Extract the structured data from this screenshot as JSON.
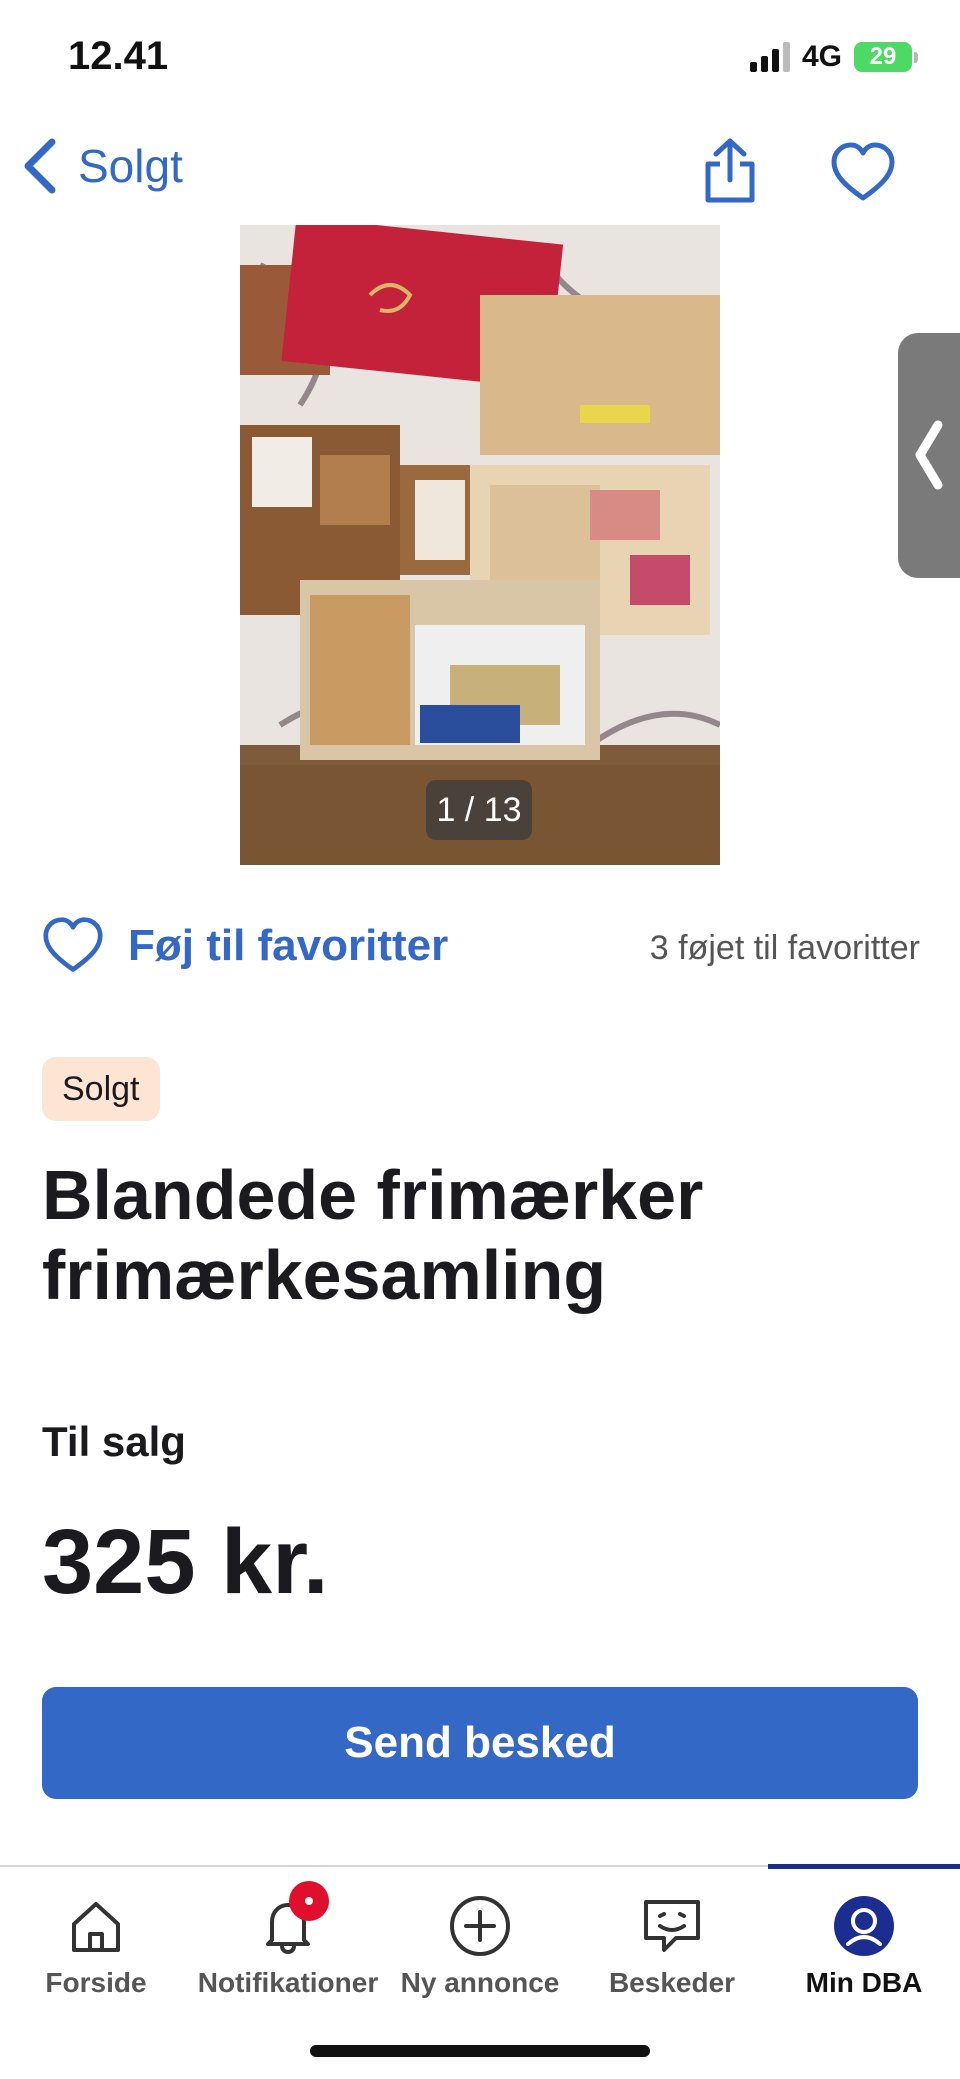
{
  "status_bar": {
    "time": "12.41",
    "network": "4G",
    "battery": "29"
  },
  "nav": {
    "back_label": "Solgt"
  },
  "gallery": {
    "counter": "1 / 13"
  },
  "favorites": {
    "add_label": "Føj til favoritter",
    "count_text": "3 føjet til favoritter"
  },
  "listing": {
    "status_badge": "Solgt",
    "title_line1": "Blandede frimærker",
    "title_line2": "frimærkesamling",
    "sale_type": "Til salg",
    "price": "325 kr."
  },
  "actions": {
    "send_message": "Send besked"
  },
  "bottom_nav": {
    "tabs": [
      {
        "label": "Forside",
        "icon": "home-icon"
      },
      {
        "label": "Notifikationer",
        "icon": "bell-icon"
      },
      {
        "label": "Ny annonce",
        "icon": "plus-circle-icon"
      },
      {
        "label": "Beskeder",
        "icon": "chat-icon"
      },
      {
        "label": "Min DBA",
        "icon": "profile-icon",
        "active": true
      }
    ]
  },
  "colors": {
    "accent": "#3368c6",
    "badge_bg": "#fde4d3",
    "active_tab": "#1b2d8f",
    "notification": "#e0102c"
  }
}
